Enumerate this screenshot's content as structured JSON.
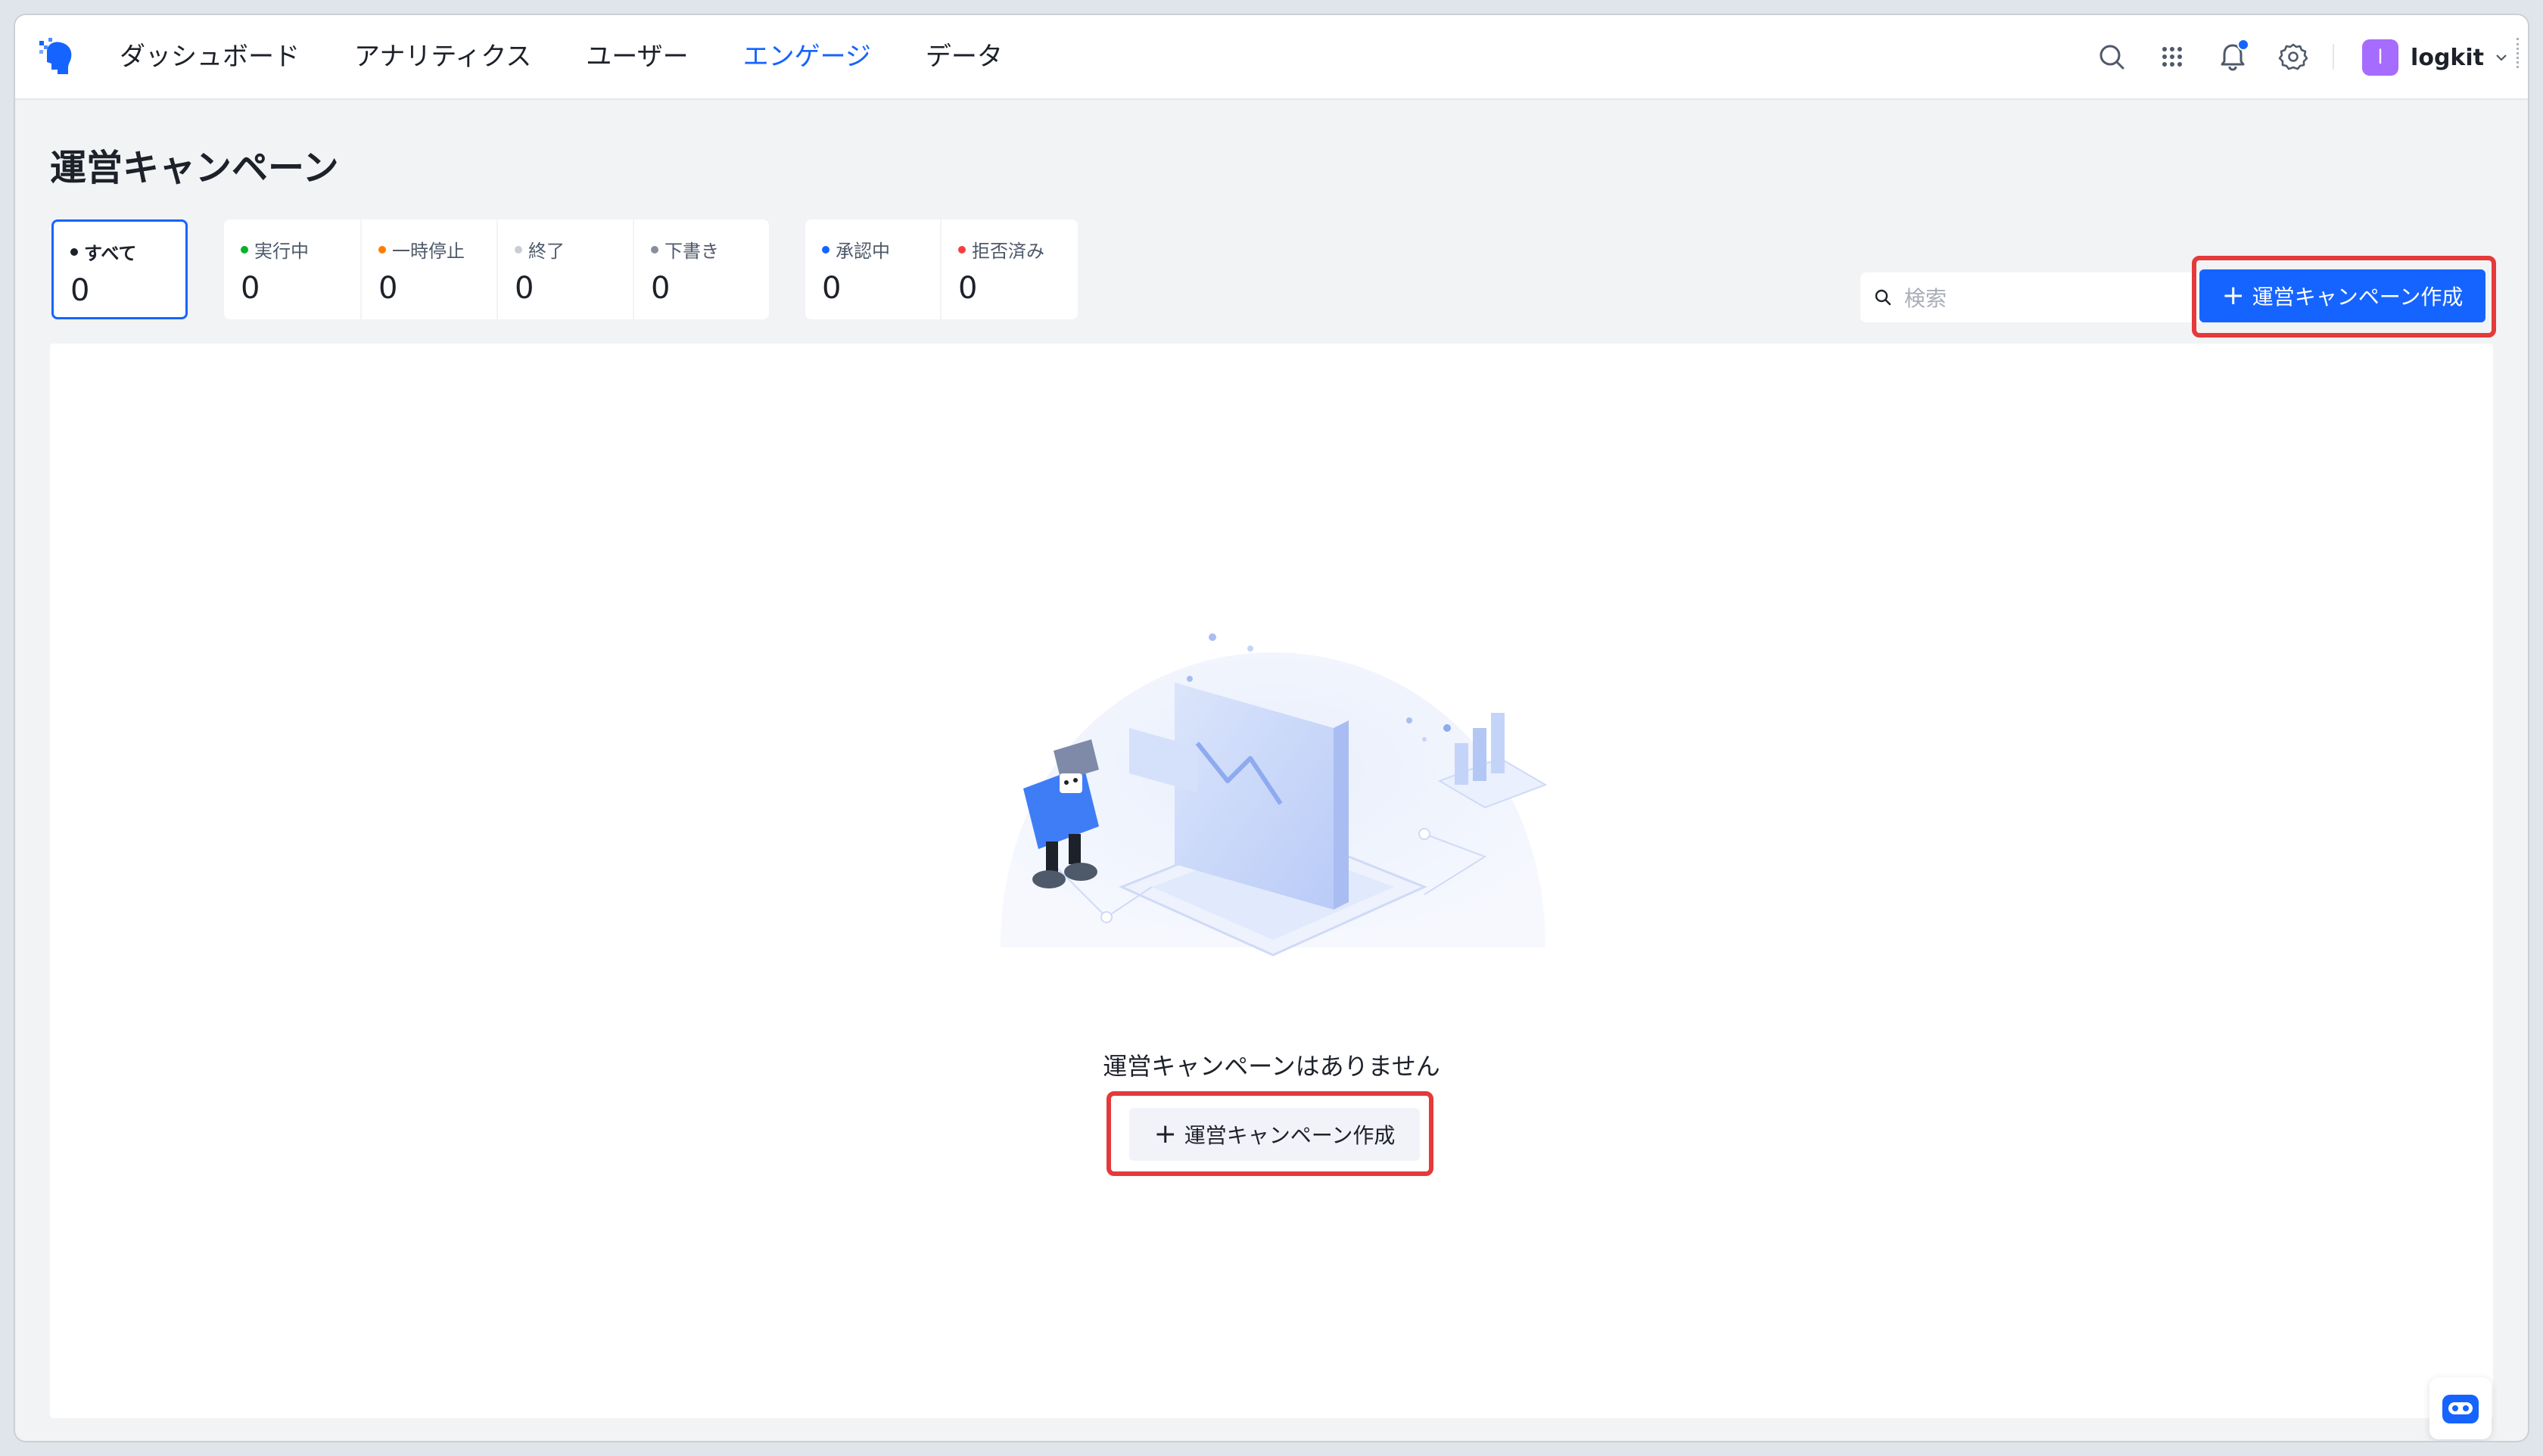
{
  "nav": {
    "items": [
      {
        "label": "ダッシュボード"
      },
      {
        "label": "アナリティクス"
      },
      {
        "label": "ユーザー"
      },
      {
        "label": "エンゲージ"
      },
      {
        "label": "データ"
      }
    ],
    "active_index": 3
  },
  "toolbar": {
    "icons": [
      "search-icon",
      "apps-grid-icon",
      "bell-icon",
      "gear-icon"
    ],
    "avatar_initial": "l",
    "username": "logkit"
  },
  "page": {
    "title": "運営キャンペーン"
  },
  "stats": {
    "all": {
      "label": "すべて",
      "value": "0",
      "dot": "#1d2129"
    },
    "running": {
      "label": "実行中",
      "value": "0",
      "dot": "#00b42a"
    },
    "paused": {
      "label": "一時停止",
      "value": "0",
      "dot": "#ff7d00"
    },
    "ended": {
      "label": "終了",
      "value": "0",
      "dot": "#c9cdd4"
    },
    "draft": {
      "label": "下書き",
      "value": "0",
      "dot": "#86909c"
    },
    "approving": {
      "label": "承認中",
      "value": "0",
      "dot": "#1664ff"
    },
    "rejected": {
      "label": "拒否済み",
      "value": "0",
      "dot": "#f53f3f"
    }
  },
  "search": {
    "placeholder": "検索",
    "value": ""
  },
  "create_button": {
    "label": "運営キャンペーン作成"
  },
  "empty": {
    "message": "運営キャンペーンはありません",
    "button_label": "運営キャンペーン作成"
  },
  "colors": {
    "accent": "#1664ff",
    "highlight": "#e5393a"
  }
}
